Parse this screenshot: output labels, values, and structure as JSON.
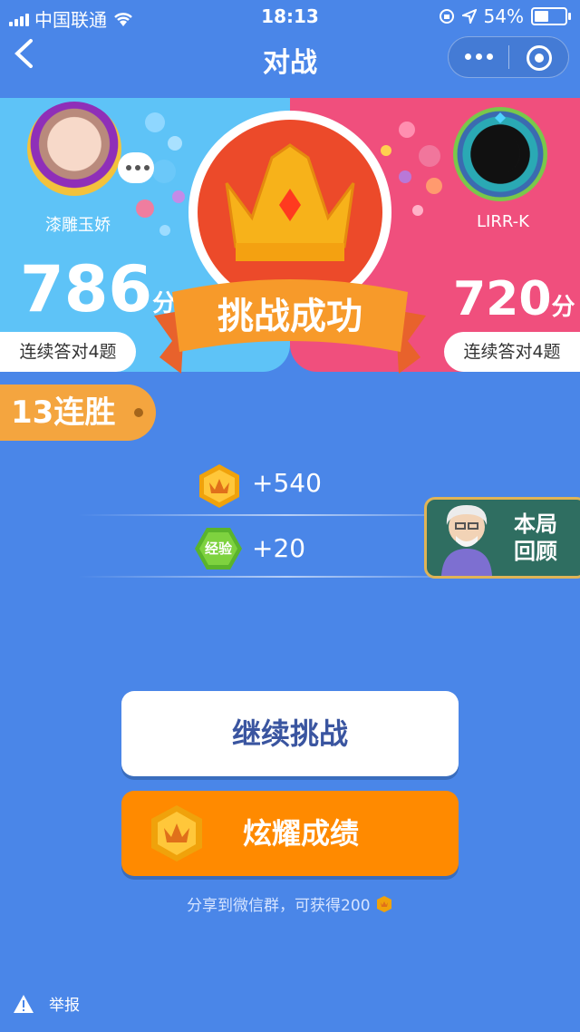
{
  "status_bar": {
    "carrier": "中国联通",
    "time": "18:13",
    "battery": "54%",
    "battery_level": 0.54
  },
  "nav": {
    "title": "对战"
  },
  "player_left": {
    "name": "漆雕玉娇",
    "score": "786",
    "unit": "分",
    "streak_answer": "连续答对4题"
  },
  "player_right": {
    "name": "LIRR-K",
    "score": "720",
    "unit": "分",
    "streak_answer": "连续答对4题"
  },
  "result": {
    "banner": "挑战成功"
  },
  "win_streak": "13连胜",
  "rewards": {
    "coins": "+540",
    "exp_badge": "经验",
    "exp": "+20"
  },
  "review": {
    "line1": "本局",
    "line2": "回顾"
  },
  "buttons": {
    "continue": "继续挑战",
    "share": "炫耀成绩"
  },
  "share_hint": "分享到微信群，可获得200",
  "report": "举报",
  "colors": {
    "bg": "#4a86e8",
    "left_panel": "#5ec3f7",
    "right_panel": "#f04f7d",
    "accent": "#ff8a00"
  }
}
